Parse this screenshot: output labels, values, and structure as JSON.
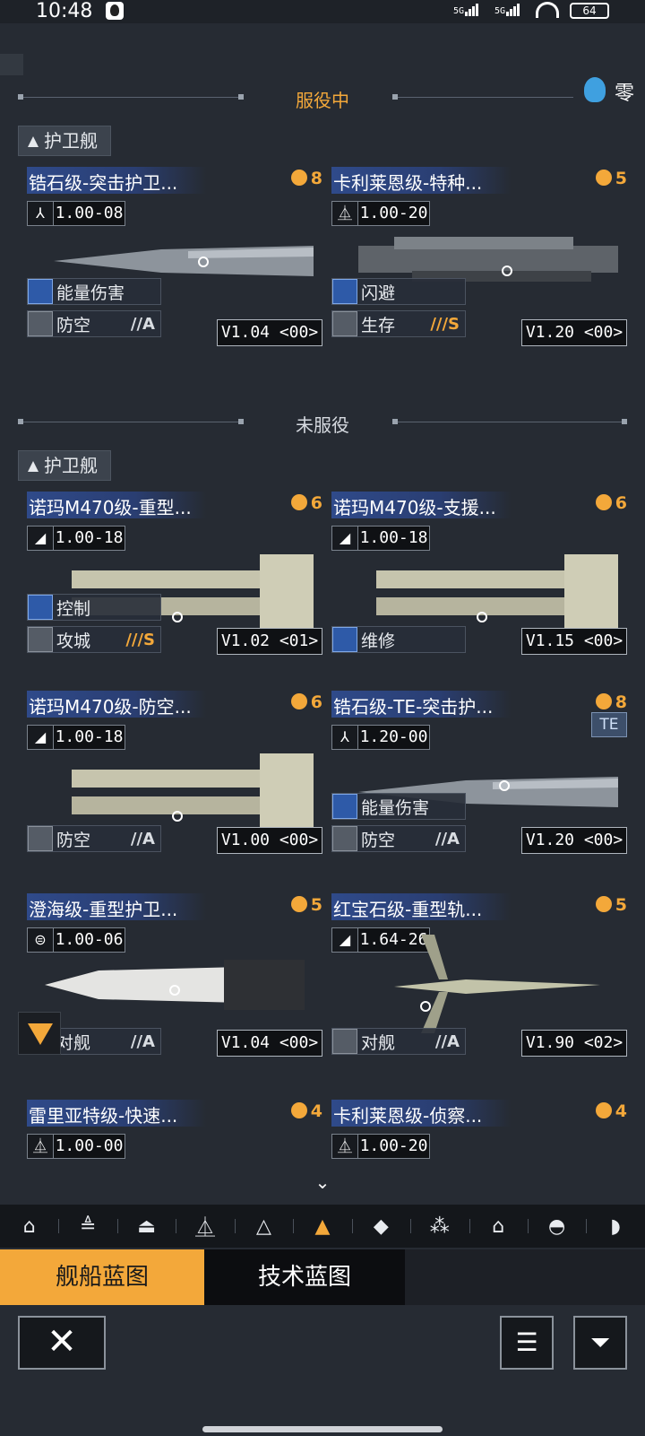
{
  "status_bar": {
    "time": "10:48",
    "signal_1": "5G",
    "signal_2": "5G",
    "battery": "64"
  },
  "header": {
    "in_service_title": "服役中",
    "not_in_service_title": "未服役",
    "user_name": "零"
  },
  "in_service": {
    "category": "护卫舰",
    "ships": [
      {
        "name": "锆石级-突击护卫...",
        "tier": "8",
        "rating_icon": "⅄",
        "rating": "1.00-08",
        "traits": [
          {
            "label": "能量伤害",
            "grade": ""
          },
          {
            "label": "防空",
            "grade": "//A"
          }
        ],
        "version": "V1.04 <00>"
      },
      {
        "name": "卡利莱恩级-特种...",
        "tier": "5",
        "rating_icon": "⏅",
        "rating": "1.00-20",
        "traits": [
          {
            "label": "闪避",
            "grade": ""
          },
          {
            "label": "生存",
            "grade": "///S"
          }
        ],
        "version": "V1.20 <00>"
      }
    ]
  },
  "not_in_service": {
    "category": "护卫舰",
    "ships": [
      {
        "name": "诺玛M470级-重型...",
        "tier": "6",
        "rating": "1.00-18",
        "traits": [
          {
            "label": "控制",
            "grade": ""
          },
          {
            "label": "攻城",
            "grade": "///S"
          }
        ],
        "version": "V1.02 <01>"
      },
      {
        "name": "诺玛M470级-支援...",
        "tier": "6",
        "rating": "1.00-18",
        "traits": [
          {
            "label": "维修",
            "grade": ""
          }
        ],
        "version": "V1.15 <00>"
      },
      {
        "name": "诺玛M470级-防空...",
        "tier": "6",
        "rating": "1.00-18",
        "traits": [
          {
            "label": "防空",
            "grade": "//A"
          }
        ],
        "version": "V1.00 <00>"
      },
      {
        "name": "锆石级-TE-突击护...",
        "tier": "8",
        "rating": "1.20-00",
        "badge": "TE",
        "traits": [
          {
            "label": "能量伤害",
            "grade": ""
          },
          {
            "label": "防空",
            "grade": "//A"
          }
        ],
        "version": "V1.20 <00>"
      },
      {
        "name": "澄海级-重型护卫...",
        "tier": "5",
        "rating": "1.00-06",
        "traits": [
          {
            "label": "对舰",
            "grade": "//A"
          }
        ],
        "version": "V1.04 <00>"
      },
      {
        "name": "红宝石级-重型轨...",
        "tier": "5",
        "rating": "1.64-26",
        "traits": [
          {
            "label": "对舰",
            "grade": "//A"
          }
        ],
        "version": "V1.90 <02>"
      },
      {
        "name": "雷里亚特级-快速...",
        "tier": "4",
        "rating": "1.00-00",
        "traits": [],
        "version": ""
      },
      {
        "name": "卡利莱恩级-侦察...",
        "tier": "4",
        "rating": "1.00-20",
        "traits": [],
        "version": ""
      }
    ]
  },
  "filter_bar": {
    "active_index": 5
  },
  "mode_tabs": {
    "ship_blueprint": "舰船蓝图",
    "tech_blueprint": "技术蓝图"
  },
  "colors": {
    "accent": "#f3a83a",
    "title_bar": "#2f4a8a",
    "background": "#262b33"
  }
}
